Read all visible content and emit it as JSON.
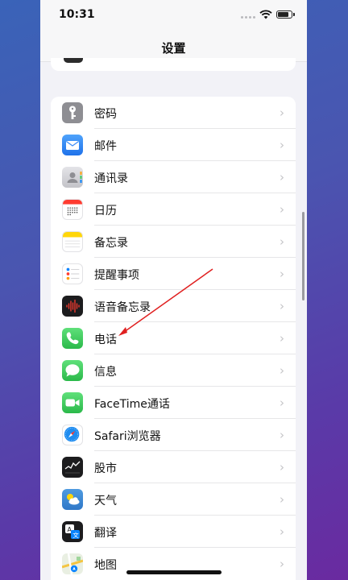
{
  "status_bar": {
    "time": "10:31"
  },
  "nav": {
    "title": "设置"
  },
  "settings": [
    {
      "label": "密码",
      "icon": "key-icon",
      "color": "#8e8e93"
    },
    {
      "label": "邮件",
      "icon": "mail-icon",
      "color": "#3b8bf7"
    },
    {
      "label": "通讯录",
      "icon": "contacts-icon",
      "color": "#c9c9ce"
    },
    {
      "label": "日历",
      "icon": "calendar-icon",
      "color": "#ffffff"
    },
    {
      "label": "备忘录",
      "icon": "notes-icon",
      "color": "#ffffff"
    },
    {
      "label": "提醒事项",
      "icon": "reminders-icon",
      "color": "#ffffff"
    },
    {
      "label": "语音备忘录",
      "icon": "voice-memos-icon",
      "color": "#1c1c1e"
    },
    {
      "label": "电话",
      "icon": "phone-icon",
      "color": "#34c759"
    },
    {
      "label": "信息",
      "icon": "messages-icon",
      "color": "#34c759"
    },
    {
      "label": "FaceTime通话",
      "icon": "facetime-icon",
      "color": "#34c759"
    },
    {
      "label": "Safari浏览器",
      "icon": "safari-icon",
      "color": "#ffffff"
    },
    {
      "label": "股市",
      "icon": "stocks-icon",
      "color": "#1c1c1e"
    },
    {
      "label": "天气",
      "icon": "weather-icon",
      "color": "#3e8fd8"
    },
    {
      "label": "翻译",
      "icon": "translate-icon",
      "color": "#1c1c1e"
    },
    {
      "label": "地图",
      "icon": "maps-icon",
      "color": "#e9efe2"
    }
  ],
  "chevron": "›"
}
